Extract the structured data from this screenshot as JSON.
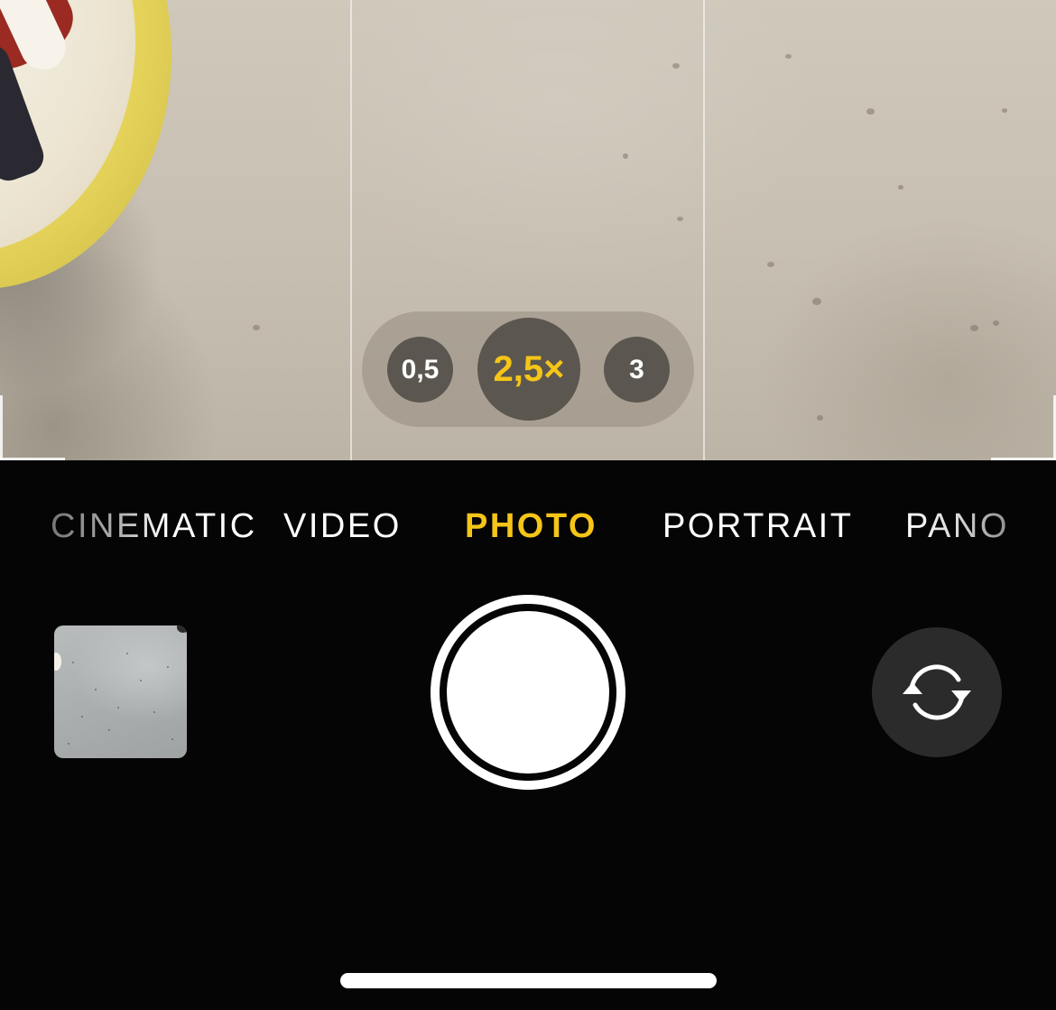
{
  "zoom": {
    "options": [
      "0,5",
      "2,5×",
      "3"
    ],
    "active": "2,5×"
  },
  "modes": {
    "cinematic": "CINEMATIC",
    "video": "VIDEO",
    "photo": "PHOTO",
    "portrait": "PORTRAIT",
    "pano": "PANO",
    "active": "PHOTO"
  },
  "icons": {
    "shutter": "shutter-button",
    "flip": "camera-flip-icon",
    "thumbnail": "last-photo-thumbnail"
  },
  "colors": {
    "accent": "#f5c518",
    "background": "#050505",
    "text": "#ffffff"
  }
}
